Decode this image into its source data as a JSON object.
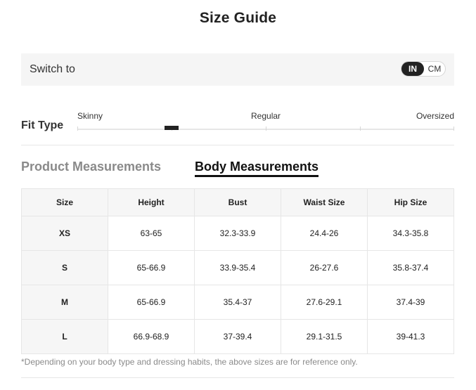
{
  "title": "Size Guide",
  "switch": {
    "label": "Switch to",
    "options": [
      "IN",
      "CM"
    ],
    "selected": "IN"
  },
  "fit": {
    "label": "Fit Type",
    "scale_labels": [
      "Skinny",
      "Regular",
      "Oversized"
    ],
    "value_fraction": 0.25
  },
  "tabs": [
    {
      "label": "Product Measurements",
      "active": false
    },
    {
      "label": "Body Measurements",
      "active": true
    }
  ],
  "table": {
    "headers": [
      "Size",
      "Height",
      "Bust",
      "Waist Size",
      "Hip Size"
    ],
    "rows": [
      [
        "XS",
        "63-65",
        "32.3-33.9",
        "24.4-26",
        "34.3-35.8"
      ],
      [
        "S",
        "65-66.9",
        "33.9-35.4",
        "26-27.6",
        "35.8-37.4"
      ],
      [
        "M",
        "65-66.9",
        "35.4-37",
        "27.6-29.1",
        "37.4-39"
      ],
      [
        "L",
        "66.9-68.9",
        "37-39.4",
        "29.1-31.5",
        "39-41.3"
      ]
    ]
  },
  "footnote": "*Depending on your body type and dressing habits, the above sizes are for reference only."
}
